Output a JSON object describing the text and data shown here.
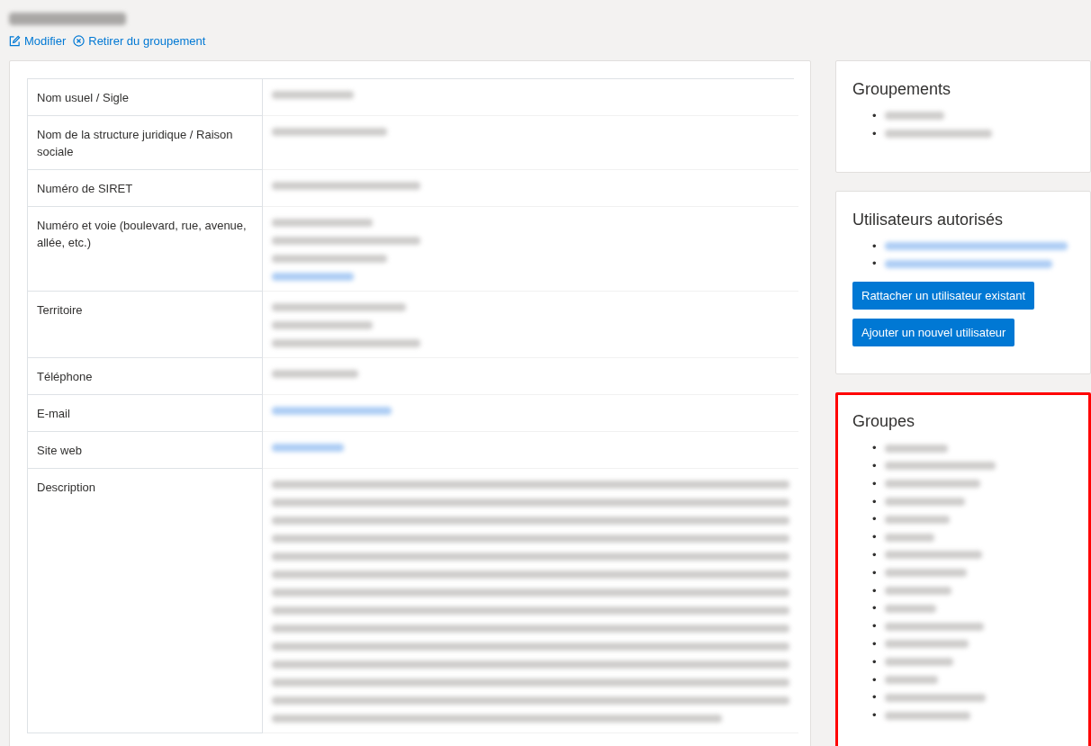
{
  "header": {
    "title": {
      "kind": "redacted"
    },
    "actions": [
      {
        "label": "Modifier"
      },
      {
        "label": "Retirer du groupement"
      }
    ]
  },
  "details": {
    "rows": [
      {
        "label": "Nom usuel / Sigle",
        "value": [
          {
            "kind": "redacted",
            "link": false
          }
        ]
      },
      {
        "label": "Nom de la structure juridique / Raison sociale",
        "value": [
          {
            "kind": "redacted",
            "link": false
          }
        ]
      },
      {
        "label": "Numéro de SIRET",
        "value": [
          {
            "kind": "redacted",
            "link": false
          }
        ]
      },
      {
        "label": "Numéro et voie (boulevard, rue, avenue, allée, etc.)",
        "value": [
          {
            "kind": "redacted",
            "link": false
          },
          {
            "kind": "redacted",
            "link": false
          },
          {
            "kind": "redacted",
            "link": false
          },
          {
            "kind": "redacted",
            "link": true
          }
        ]
      },
      {
        "label": "Territoire",
        "value": [
          {
            "kind": "redacted",
            "link": false
          },
          {
            "kind": "redacted",
            "link": false
          },
          {
            "kind": "redacted",
            "link": false
          }
        ]
      },
      {
        "label": "Téléphone",
        "value": [
          {
            "kind": "redacted",
            "link": false
          }
        ]
      },
      {
        "label": "E-mail",
        "value": [
          {
            "kind": "redacted",
            "link": true
          }
        ]
      },
      {
        "label": "Site web",
        "value": [
          {
            "kind": "redacted",
            "link": true
          }
        ]
      },
      {
        "label": "Description",
        "value": [
          {
            "kind": "redacted",
            "link": false
          },
          {
            "kind": "redacted",
            "link": false
          },
          {
            "kind": "redacted",
            "link": false
          },
          {
            "kind": "redacted",
            "link": false
          },
          {
            "kind": "redacted",
            "link": false
          },
          {
            "kind": "redacted",
            "link": false
          },
          {
            "kind": "redacted",
            "link": false
          },
          {
            "kind": "redacted",
            "link": false
          },
          {
            "kind": "redacted",
            "link": false
          },
          {
            "kind": "redacted",
            "link": false
          },
          {
            "kind": "redacted",
            "link": false
          },
          {
            "kind": "redacted",
            "link": false
          },
          {
            "kind": "redacted",
            "link": false
          },
          {
            "kind": "redacted",
            "link": false
          }
        ]
      }
    ]
  },
  "sidebar": [
    {
      "title": "Groupements",
      "highlighted": false,
      "items": [
        {
          "bullet": "•",
          "kind": "redacted",
          "link": false
        },
        {
          "bullet": "•",
          "kind": "redacted",
          "link": false
        }
      ]
    },
    {
      "title": "Utilisateurs autorisés",
      "highlighted": false,
      "items": [
        {
          "bullet": "•",
          "kind": "redacted",
          "link": true
        },
        {
          "bullet": "•",
          "kind": "redacted",
          "link": true
        }
      ],
      "buttons": [
        "Rattacher un utilisateur existant",
        "Ajouter un nouvel utilisateur"
      ]
    },
    {
      "title": "Groupes",
      "highlighted": true,
      "items": [
        {
          "bullet": "•",
          "kind": "redacted",
          "link": false
        },
        {
          "bullet": "•",
          "kind": "redacted",
          "link": false
        },
        {
          "bullet": "•",
          "kind": "redacted",
          "link": false
        },
        {
          "bullet": "•",
          "kind": "redacted",
          "link": false
        },
        {
          "bullet": "•",
          "kind": "redacted",
          "link": false
        },
        {
          "bullet": "•",
          "kind": "redacted",
          "link": false
        },
        {
          "bullet": "•",
          "kind": "redacted",
          "link": false
        },
        {
          "bullet": "•",
          "kind": "redacted",
          "link": false
        },
        {
          "bullet": "•",
          "kind": "redacted",
          "link": false
        },
        {
          "bullet": "•",
          "kind": "redacted",
          "link": false
        },
        {
          "bullet": "•",
          "kind": "redacted",
          "link": false
        },
        {
          "bullet": "•",
          "kind": "redacted",
          "link": false
        },
        {
          "bullet": "•",
          "kind": "redacted",
          "link": false
        },
        {
          "bullet": "•",
          "kind": "redacted",
          "link": false
        },
        {
          "bullet": "•",
          "kind": "redacted",
          "link": false
        },
        {
          "bullet": "•",
          "kind": "redacted",
          "link": false
        }
      ]
    }
  ]
}
